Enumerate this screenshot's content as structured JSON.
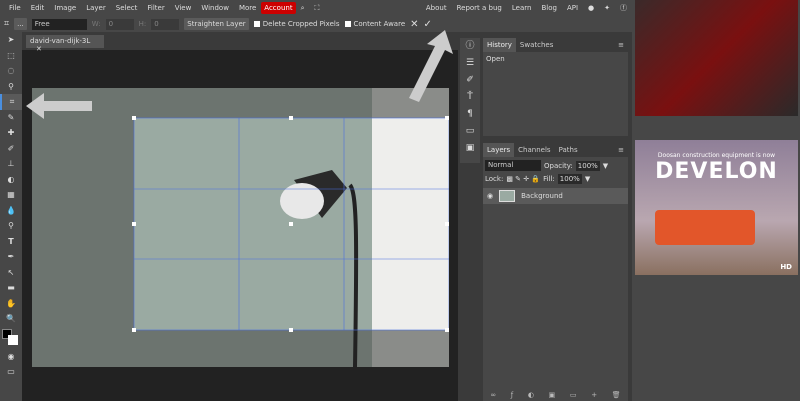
{
  "menu": {
    "items": [
      "File",
      "Edit",
      "Image",
      "Layer",
      "Select",
      "Filter",
      "View",
      "Window",
      "More"
    ],
    "account": "Account",
    "right": [
      "About",
      "Report a bug",
      "Learn",
      "Blog",
      "API"
    ]
  },
  "options": {
    "more": "...",
    "ratio": "Free",
    "w_label": "W:",
    "w_value": "0",
    "h_label": "H:",
    "h_value": "0",
    "straighten": "Straighten Layer",
    "delete_cropped": "Delete Cropped Pixels",
    "content_aware": "Content Aware",
    "cancel": "✕",
    "commit": "✓"
  },
  "document": {
    "tab": "david-van-dijk-3L",
    "close": "✕"
  },
  "history": {
    "tabs": [
      "History",
      "Swatches"
    ],
    "items": [
      "Open"
    ]
  },
  "layers": {
    "tabs": [
      "Layers",
      "Channels",
      "Paths"
    ],
    "blend": "Normal",
    "opacity_label": "Opacity:",
    "opacity": "100%",
    "lock_label": "Lock:",
    "fill_label": "Fill:",
    "fill": "100%",
    "items": [
      {
        "name": "Background",
        "visible": true
      }
    ]
  },
  "ad": {
    "headline": "Doosan construction equipment is now",
    "brand": "DEVELON",
    "logo": "HD"
  },
  "colors": {
    "accent": "#cc0000",
    "foreground": "#000000",
    "background": "#ffffff"
  }
}
